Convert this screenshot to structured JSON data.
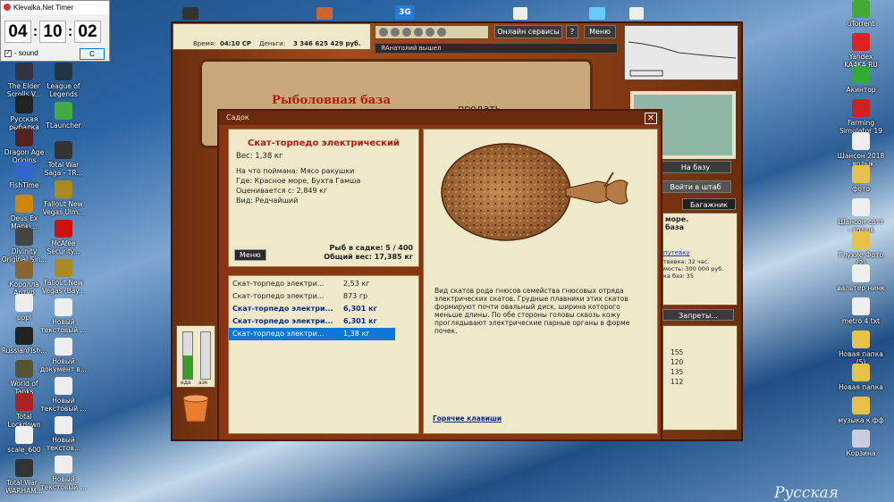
{
  "desktop_icons_left": [
    {
      "label": "The Elder Scrolls V...",
      "icon": "elder-scrolls-icon",
      "color": "#334"
    },
    {
      "label": "Русская рыбалка",
      "icon": "rr3-icon",
      "color": "#222"
    },
    {
      "label": "Dragon Age Origins",
      "icon": "dragon-age-icon",
      "color": "#522"
    },
    {
      "label": "FishTime",
      "icon": "fishtime-icon",
      "color": "#36c"
    },
    {
      "label": "Deus Ex Manki...",
      "icon": "deus-ex-icon",
      "color": "#c80"
    },
    {
      "label": "Divinity Original Sin...",
      "icon": "divinity-icon",
      "color": "#444"
    },
    {
      "label": "Королла Артур",
      "icon": "korolla-icon",
      "color": "#863"
    },
    {
      "label": "popl",
      "icon": "file-icon",
      "color": "#eee"
    },
    {
      "label": "RussianFish...",
      "icon": "rr3-icon",
      "color": "#222"
    },
    {
      "label": "World of Tanks",
      "icon": "wot-icon",
      "color": "#553"
    },
    {
      "label": "Total Lockdown",
      "icon": "lockdown-icon",
      "color": "#a22"
    },
    {
      "label": "scale_600",
      "icon": "file-icon",
      "color": "#eee"
    },
    {
      "label": "Total War - WARHAM...",
      "icon": "total-war-icon",
      "color": "#333"
    }
  ],
  "desktop_icons_left2": [
    {
      "label": "League of Legends",
      "icon": "lol-icon",
      "color": "#234"
    },
    {
      "label": "TLauncher",
      "icon": "tlauncher-icon",
      "color": "#4a4"
    },
    {
      "label": "Total War Saga - TR...",
      "icon": "total-war-icon",
      "color": "#333"
    },
    {
      "label": "Fallout New Vegas Ulm...",
      "icon": "fallout-icon",
      "color": "#a82"
    },
    {
      "label": "McAfee Security...",
      "icon": "mcafee-icon",
      "color": "#c11"
    },
    {
      "label": "Fallout New Vegas (Bay...",
      "icon": "fallout-icon",
      "color": "#a82"
    },
    {
      "label": "Новый текстовый ...",
      "icon": "text-file-icon",
      "color": "#eee"
    },
    {
      "label": "Новый документ в...",
      "icon": "text-file-icon",
      "color": "#eee"
    },
    {
      "label": "Новый текстовый ...",
      "icon": "text-file-icon",
      "color": "#eee"
    },
    {
      "label": "Новый текстов...",
      "icon": "text-file-icon",
      "color": "#eee"
    },
    {
      "label": "Новый текстовый ...",
      "icon": "text-file-icon",
      "color": "#eee"
    }
  ],
  "desktop_icons_right": [
    {
      "label": "uTorrent",
      "icon": "utorrent-icon",
      "color": "#4a3"
    },
    {
      "label": "Yandex KA4KA.RU",
      "icon": "yandex-icon",
      "color": "#d22"
    },
    {
      "label": "Акинтор",
      "icon": "akinator-icon",
      "color": "#3a3"
    },
    {
      "label": "Farming Simulator 19",
      "icon": "farming-icon",
      "color": "#c22"
    },
    {
      "label": "Шансон 2018 - ярлык",
      "icon": "chanson-icon",
      "color": "#eee"
    },
    {
      "label": "фото",
      "icon": "folder-icon",
      "color": "#e8c14a"
    },
    {
      "label": "Шансон сотт - ярлык",
      "icon": "chanson-icon",
      "color": "#eee"
    },
    {
      "label": "Глухие Фото (2)",
      "icon": "folder-icon",
      "color": "#e8c14a"
    },
    {
      "label": "вальтер нинк",
      "icon": "file-icon",
      "color": "#eee"
    },
    {
      "label": "metro 4.txt",
      "icon": "text-file-icon",
      "color": "#eee"
    },
    {
      "label": "Новая папка (5)",
      "icon": "folder-icon",
      "color": "#e8c14a"
    },
    {
      "label": "Новая папка",
      "icon": "folder-icon",
      "color": "#e8c14a"
    },
    {
      "label": "музыка к фф",
      "icon": "folder-icon",
      "color": "#e8c14a"
    },
    {
      "label": "Корзина",
      "icon": "recycle-bin-icon",
      "color": "#ccd"
    }
  ],
  "desktop_watermark": "Русская",
  "timer": {
    "title": "Klevalka.Net Timer",
    "hours": "04",
    "minutes": "10",
    "seconds": "02",
    "sound_label": "- sound",
    "sound_checked": "✓",
    "button_label": "C"
  },
  "game": {
    "time_label": "Время:",
    "time_value": "04:10 СР",
    "money_label": "Деньги:",
    "money_value": "3 346 625 429 руб.",
    "online_services": "Онлайн сервисы",
    "help": "?",
    "menu": "Меню",
    "chat_line": "ЯАнатолий вышел",
    "book_title": "Рыболовная база",
    "book_sell": "продать",
    "to_base": "На базу",
    "to_headquarters": "Войти в штаб",
    "baggage": "Багажник",
    "side_text_1": "море.",
    "side_text_2": "база",
    "side_link": "путевку",
    "side_details": [
      "твевка: 32 час.",
      "мость: 300 000 руб.",
      "ка баз: 35"
    ],
    "bans": "Запреты...",
    "numbers": [
      "155",
      "120",
      "135",
      "112"
    ],
    "meter_labels": [
      "еда",
      "азк"
    ]
  },
  "dialog": {
    "title": "Садок",
    "close": "✕",
    "fish_name": "Скат-торпедо электрический",
    "weight": "Вес: 1,38 кг",
    "caught_on": "На что поймана: Мясо ракушки",
    "where": "Где: Красное море, Бухта Гамша",
    "value": "Оценивается с: 2,849 кг",
    "kind": "Вид: Редчайший",
    "menu_button": "Меню",
    "fish_count": "Рыб в садке: 5 / 400",
    "total_weight": "Общий вес: 17,385 кг",
    "fish_list": [
      {
        "name": "Скат-торпедо электри...",
        "weight": "2,53 кг",
        "style": "normal"
      },
      {
        "name": "Скат-торпедо электри...",
        "weight": "873 гр",
        "style": "normal"
      },
      {
        "name": "Скат-торпедо электри...",
        "weight": "6,301 кг",
        "style": "bold"
      },
      {
        "name": "Скат-торпедо электри...",
        "weight": "6,301 кг",
        "style": "bold"
      },
      {
        "name": "Скат-торпедо электри...",
        "weight": "1,38 кг",
        "style": "selected"
      }
    ],
    "description": "Вид скатов рода гнюсов семейства гнюсовых отряда электрических скатов. Грудные плавники этих скатов формируют почти овальный диск, ширина которого меньше длины. По обе стороны головы сквозь кожу проглядывают электрические парные органы в форме почек.",
    "hotkeys": "Горячие клавиши"
  }
}
